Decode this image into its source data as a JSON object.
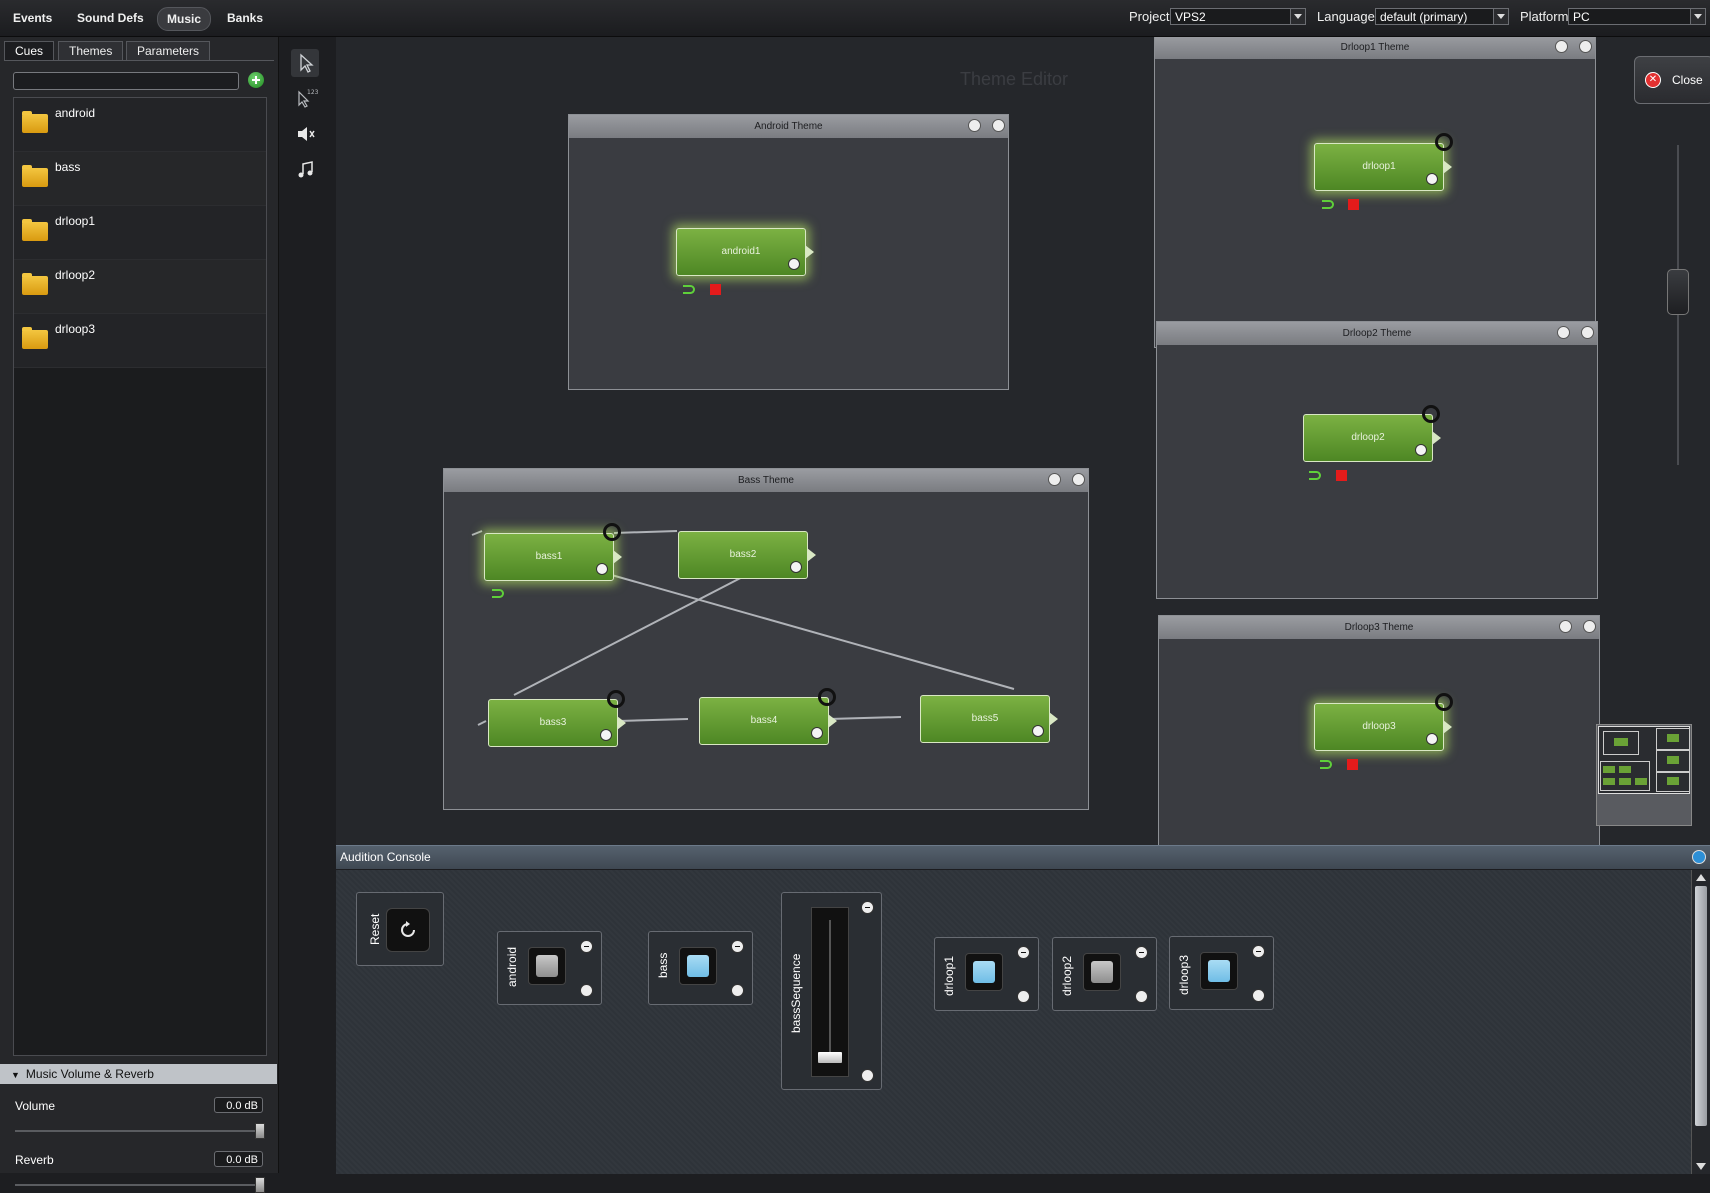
{
  "topbar": {
    "nav": [
      "Events",
      "Sound Defs",
      "Music",
      "Banks"
    ],
    "active_nav": "Music",
    "project_label": "Project",
    "project_value": "VPS2",
    "language_label": "Language",
    "language_value": "default (primary)",
    "platform_label": "Platform",
    "platform_value": "PC"
  },
  "left": {
    "tabs": [
      "Cues",
      "Themes",
      "Parameters"
    ],
    "search_value": "",
    "cues": [
      "android",
      "bass",
      "drloop1",
      "drloop2",
      "drloop3"
    ],
    "music_vol_header": "Music Volume & Reverb",
    "volume_label": "Volume",
    "volume_value": "0.0 dB",
    "volume_level": 1.0,
    "reverb_label": "Reverb",
    "reverb_value": "0.0 dB",
    "reverb_level": 1.0
  },
  "tools": [
    "pointer-icon",
    "pointer-123-icon",
    "speaker-icon",
    "music-note-icon"
  ],
  "canvas": {
    "editor_title": "Theme Editor",
    "close_label": "Close",
    "themes": {
      "android": {
        "title": "Android Theme",
        "nodes": [
          "android1"
        ]
      },
      "bass": {
        "title": "Bass Theme",
        "nodes": [
          "bass1",
          "bass2",
          "bass3",
          "bass4",
          "bass5"
        ]
      },
      "drloop1": {
        "title": "Drloop1 Theme",
        "nodes": [
          "drloop1"
        ]
      },
      "drloop2": {
        "title": "Drloop2 Theme",
        "nodes": [
          "drloop2"
        ]
      },
      "drloop3": {
        "title": "Drloop3 Theme",
        "nodes": [
          "drloop3"
        ]
      }
    }
  },
  "console": {
    "title": "Audition Console",
    "reset_label": "Reset",
    "cues": [
      "android",
      "bass",
      "bassSequence",
      "drloop1",
      "drloop2",
      "drloop3"
    ],
    "cue_active": {
      "android": false,
      "bass": true,
      "drloop1": true,
      "drloop2": false,
      "drloop3": true
    }
  },
  "colors": {
    "node_green": "#6aa236",
    "stop_red": "#e41b1b",
    "play_green": "#5fd03a",
    "active_cue_blue": "#a9dcf4",
    "inactive_cue_gray": "#c8c8c8"
  }
}
